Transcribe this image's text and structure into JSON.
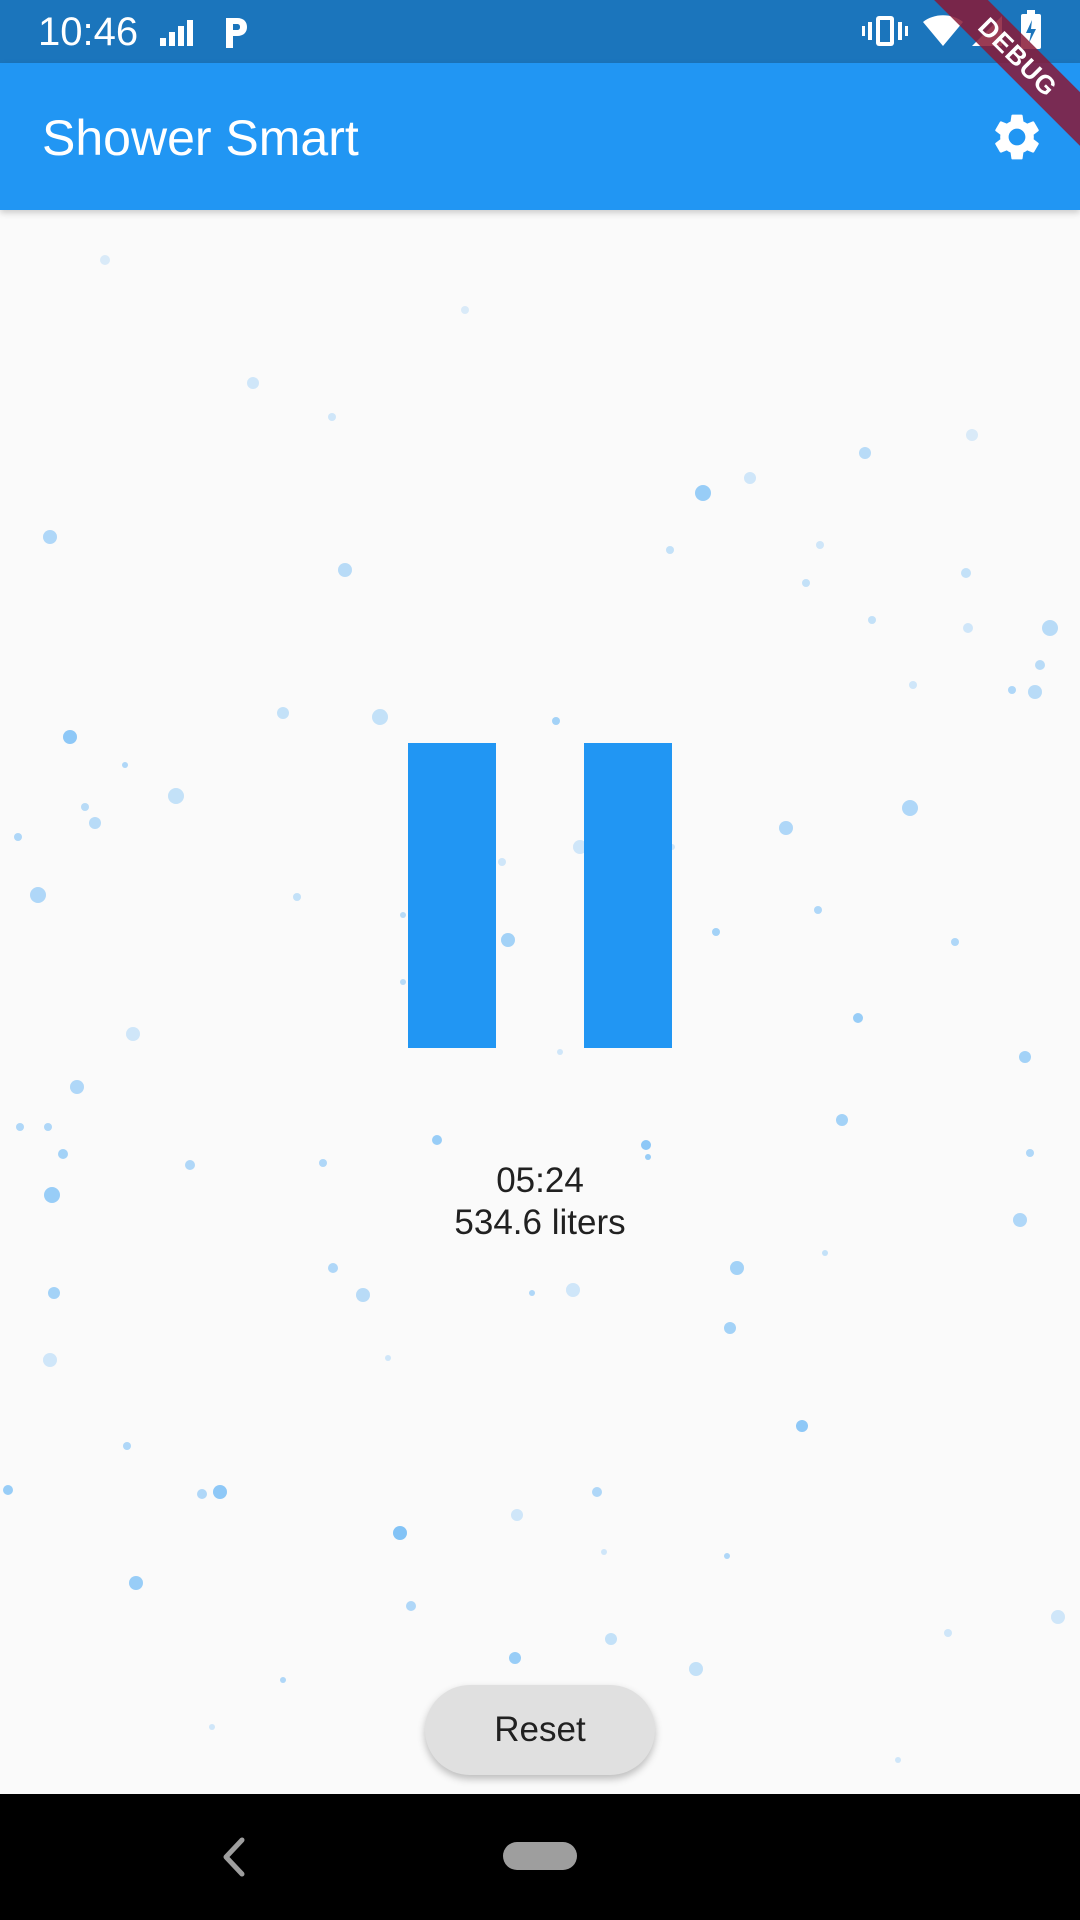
{
  "status_bar": {
    "time": "10:46",
    "background": "#1b75bc"
  },
  "app_bar": {
    "title": "Shower Smart",
    "background": "#2196f3",
    "settings_icon": "gear-icon"
  },
  "debug_banner": {
    "label": "DEBUG"
  },
  "shower": {
    "state_icon": "pause-icon",
    "elapsed_time": "05:24",
    "volume": "534.6 liters",
    "accent": "#2196f3"
  },
  "actions": {
    "reset_label": "Reset"
  },
  "navigation": {
    "back_icon": "back-chevron-icon",
    "home_icon": "home-pill-icon"
  }
}
